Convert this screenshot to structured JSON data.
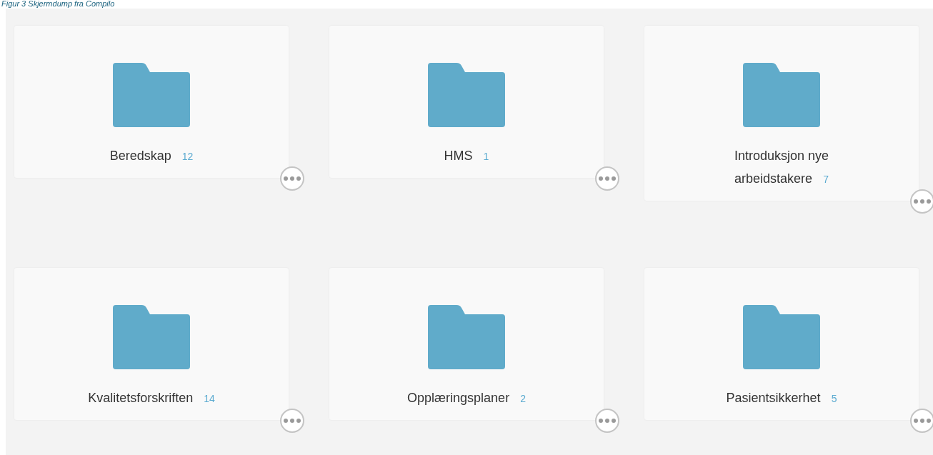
{
  "caption": "Figur 3 Skjermdump fra Compilo",
  "folders": [
    {
      "name": "Beredskap",
      "count": "12"
    },
    {
      "name": "HMS",
      "count": "1"
    },
    {
      "name": "Introduksjon nye arbeidstakere",
      "count": "7"
    },
    {
      "name": "Kvalitetsforskriften",
      "count": "14"
    },
    {
      "name": "Opplæringsplaner",
      "count": "2"
    },
    {
      "name": "Pasientsikkerhet",
      "count": "5"
    }
  ]
}
